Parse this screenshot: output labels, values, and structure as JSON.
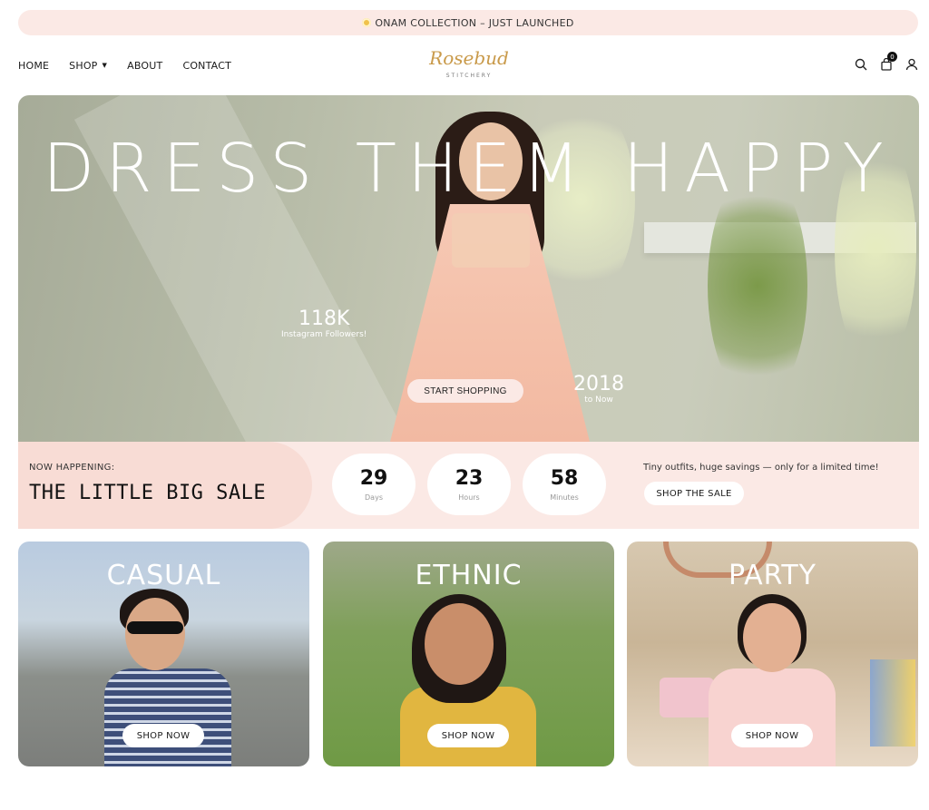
{
  "announcement": {
    "text": "ONAM COLLECTION – JUST LAUNCHED"
  },
  "nav": {
    "items": [
      {
        "label": "HOME"
      },
      {
        "label": "SHOP"
      },
      {
        "label": "ABOUT"
      },
      {
        "label": "CONTACT"
      }
    ]
  },
  "logo": {
    "name": "Rosebud",
    "sub": "STITCHERY"
  },
  "header_icons": {
    "search": "search-icon",
    "cart": "bag-icon",
    "cart_count": "0",
    "account": "user-icon"
  },
  "hero": {
    "title": "DRESS THEM HAPPY",
    "stat1": {
      "value": "118K",
      "label": "Instagram Followers!"
    },
    "stat2": {
      "value": "2018",
      "label": "to Now"
    },
    "cta": "START SHOPPING"
  },
  "sale": {
    "kicker": "NOW HAPPENING:",
    "title": "THE LITTLE BIG SALE",
    "countdown": [
      {
        "value": "29",
        "unit": "Days"
      },
      {
        "value": "23",
        "unit": "Hours"
      },
      {
        "value": "58",
        "unit": "Minutes"
      }
    ],
    "message": "Tiny outfits, huge savings — only for a limited time!",
    "cta": "SHOP THE SALE"
  },
  "categories": [
    {
      "title": "CASUAL",
      "cta": "SHOP NOW"
    },
    {
      "title": "ETHNIC",
      "cta": "SHOP NOW"
    },
    {
      "title": "PARTY",
      "cta": "SHOP NOW"
    }
  ],
  "colors": {
    "accent_pink": "#fbe9e5",
    "sale_left": "#f8dcd5",
    "logo_gold": "#c99a4a"
  }
}
